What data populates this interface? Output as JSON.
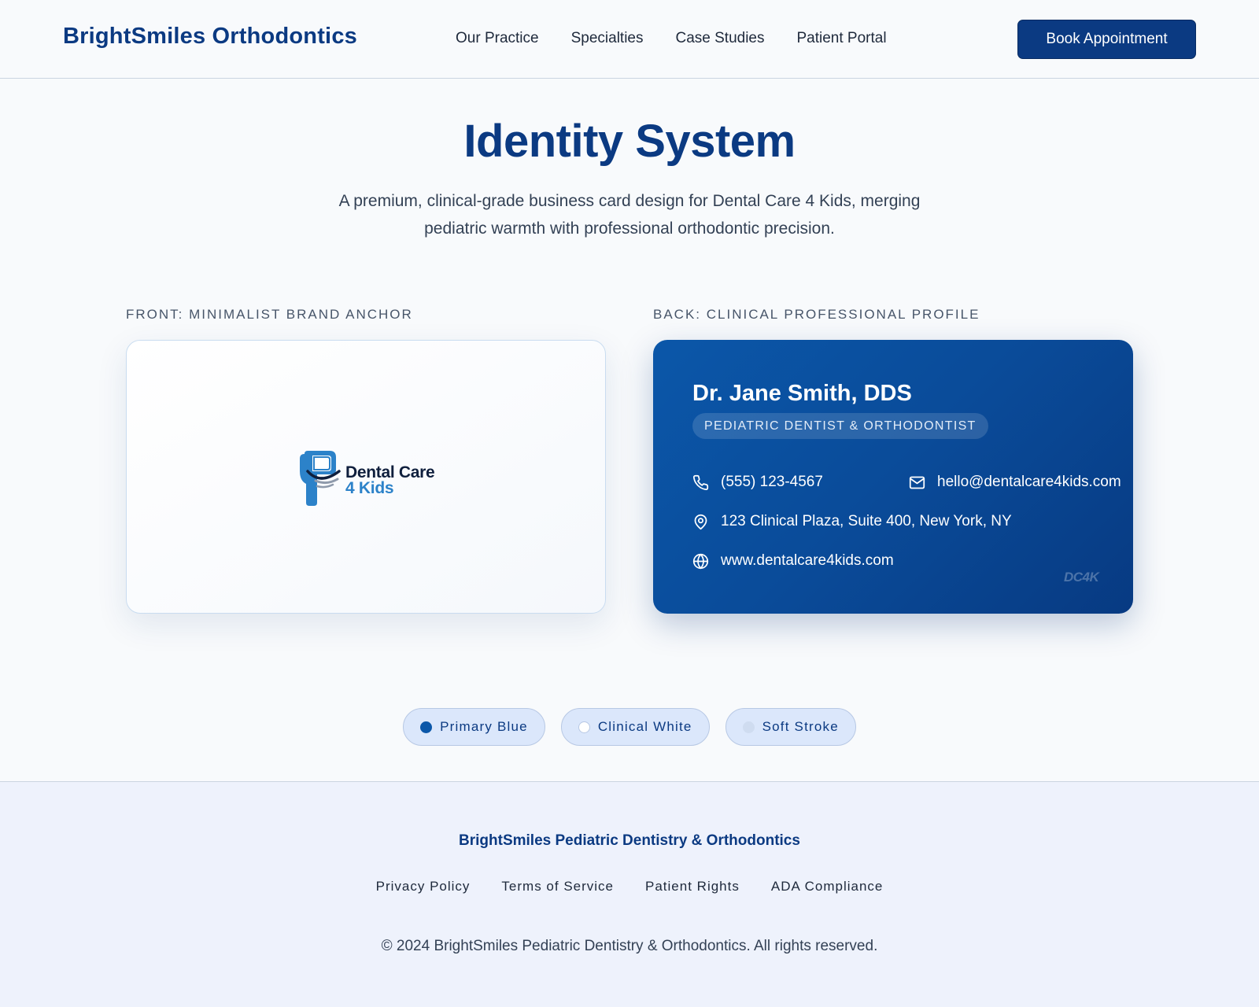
{
  "header": {
    "brand": "BrightSmiles Orthodontics",
    "nav": [
      "Our Practice",
      "Specialties",
      "Case Studies",
      "Patient Portal"
    ],
    "cta_label": "Book Appointment"
  },
  "hero": {
    "title": "Identity System",
    "subtitle": "A premium, clinical-grade business card design for Dental Care 4 Kids, merging pediatric warmth with professional orthodontic precision."
  },
  "front_card": {
    "label": "FRONT: MINIMALIST BRAND ANCHOR",
    "logo_line1": "Dental Care",
    "logo_line2": "4 Kids"
  },
  "back_card": {
    "label": "BACK: CLINICAL PROFESSIONAL PROFILE",
    "name": "Dr. Jane Smith, DDS",
    "title": "PEDIATRIC DENTIST & ORTHODONTIST",
    "phone": "(555) 123-4567",
    "email": "hello@dentalcare4kids.com",
    "address": "123 Clinical Plaza, Suite 400, New York, NY",
    "website": "www.dentalcare4kids.com",
    "watermark": "DC4K"
  },
  "swatches": [
    {
      "label": "Primary Blue",
      "color": "#0b57a9"
    },
    {
      "label": "Clinical White",
      "color": "#ffffff"
    },
    {
      "label": "Soft Stroke",
      "color": "#cfdcf0"
    }
  ],
  "footer": {
    "brand": "BrightSmiles Pediatric Dentistry & Orthodontics",
    "links": [
      "Privacy Policy",
      "Terms of Service",
      "Patient Rights",
      "ADA Compliance"
    ],
    "copyright": "© 2024 BrightSmiles Pediatric Dentistry & Orthodontics. All rights reserved."
  },
  "icons": {
    "phone": "phone-icon",
    "email": "mail-icon",
    "address": "map-pin-icon",
    "website": "globe-icon",
    "logo": "tooth-smile-icon"
  },
  "colors": {
    "brand_navy": "#0b3a82",
    "card_blue": "#0b57a9",
    "logo_blue": "#2c82c9",
    "footer_bg": "#eef2fc"
  }
}
